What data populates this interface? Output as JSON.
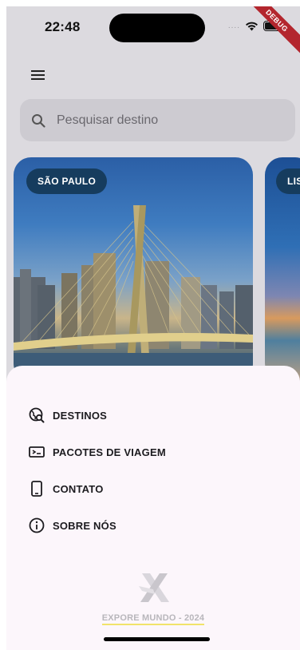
{
  "status_bar": {
    "time": "22:48",
    "dots": "....",
    "debug_label": "DEBUG"
  },
  "header": {
    "menu_icon": "hamburger-icon"
  },
  "search": {
    "placeholder": "Pesquisar destino",
    "icon": "search-icon"
  },
  "cards": [
    {
      "label": "SÃO PAULO"
    },
    {
      "label": "LIS"
    }
  ],
  "drawer": {
    "items": [
      {
        "label": "DESTINOS",
        "icon": "globe-search-icon"
      },
      {
        "label": "PACOTES DE VIAGEM",
        "icon": "ticket-icon"
      },
      {
        "label": "CONTATO",
        "icon": "smartphone-icon"
      },
      {
        "label": "SOBRE NÓS",
        "icon": "info-icon"
      }
    ],
    "footer": "EXPORE MUNDO - 2024",
    "logo_icon": "plane-logo-icon"
  },
  "colors": {
    "badge": "#163c5e",
    "sheet": "#fcf6fb",
    "background": "#dcdadf",
    "debug": "#b3262e"
  }
}
